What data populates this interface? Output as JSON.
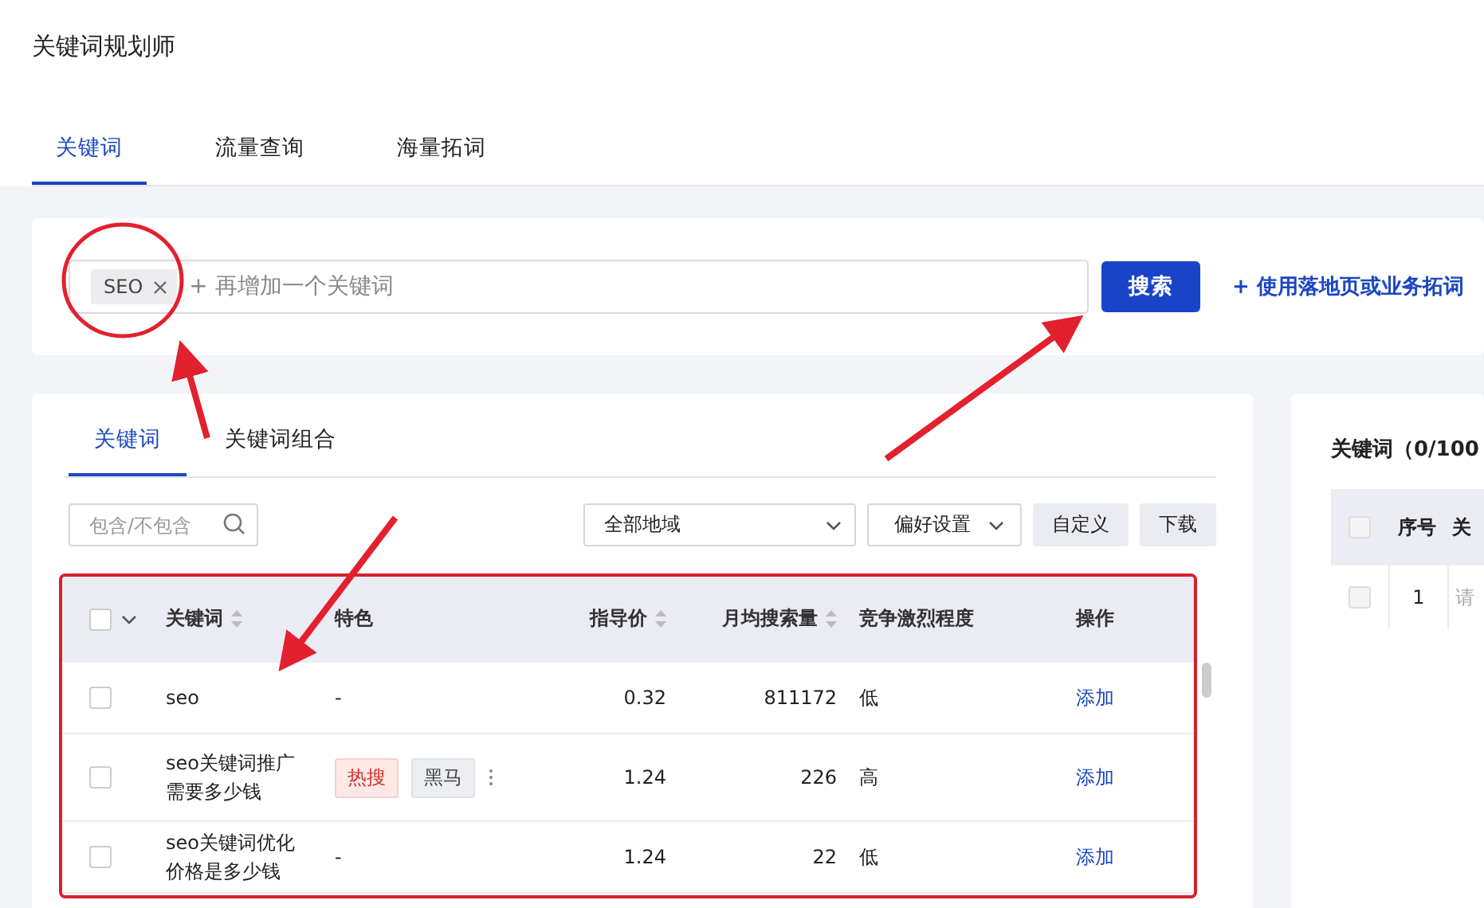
{
  "app_title": "关键词规划师",
  "tabs": [
    {
      "label": "关键词",
      "selected": true
    },
    {
      "label": "流量查询",
      "selected": false
    },
    {
      "label": "海量拓词",
      "selected": false
    }
  ],
  "search": {
    "chips": [
      "SEO"
    ],
    "placeholder": "+ 再增加一个关键词",
    "button": "搜索",
    "link": "+ 使用落地页或业务拓词"
  },
  "results": {
    "tabs": [
      {
        "label": "关键词",
        "selected": true
      },
      {
        "label": "关键词组合",
        "selected": false
      }
    ],
    "filter": {
      "placeholder": "包含/不包含"
    },
    "region": "全部地域",
    "preference": "偏好设置",
    "buttons": [
      "自定义",
      "下载"
    ],
    "all_checked": false,
    "columns": [
      {
        "label": "关键词",
        "sortable": true
      },
      {
        "label": "特色",
        "sortable": false
      },
      {
        "label": "指导价",
        "sortable": true
      },
      {
        "label": "月均搜索量",
        "sortable": true
      },
      {
        "label": "竞争激烈程度",
        "sortable": false
      },
      {
        "label": "操作",
        "sortable": false
      }
    ],
    "rows": [
      {
        "checked": false,
        "keyword": "seo",
        "features": [],
        "placeholder_feature": "-",
        "more": false,
        "price": "0.32",
        "volume": "811172",
        "competition": "低",
        "action": "添加"
      },
      {
        "checked": false,
        "keyword": "seo关键词推广需要多少钱",
        "features": [
          {
            "label": "热搜",
            "kind": "hot"
          },
          {
            "label": "黑马",
            "kind": "neutral"
          }
        ],
        "more": true,
        "price": "1.24",
        "volume": "226",
        "competition": "高",
        "action": "添加"
      },
      {
        "checked": false,
        "keyword": "seo关键词优化价格是多少钱",
        "features": [],
        "placeholder_feature": "-",
        "more": false,
        "price": "1.24",
        "volume": "22",
        "competition": "低",
        "action": "添加"
      }
    ]
  },
  "selected_panel": {
    "title": "关键词（0/100",
    "all_checked": false,
    "columns": [
      "序号",
      "关"
    ],
    "rows": [
      {
        "checked": false,
        "index": "1",
        "keyword_placeholder": "请"
      }
    ]
  }
}
